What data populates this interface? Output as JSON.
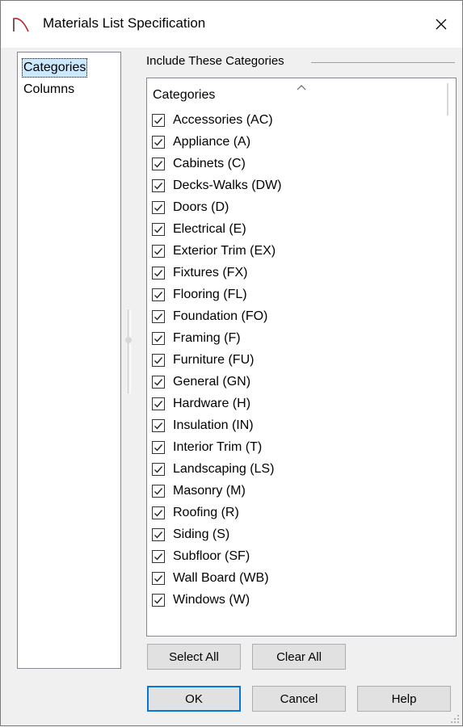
{
  "window": {
    "title": "Materials List Specification",
    "app_icon": "arc-icon",
    "close_icon": "close-icon"
  },
  "nav": {
    "items": [
      {
        "label": "Categories",
        "selected": true
      },
      {
        "label": "Columns",
        "selected": false
      }
    ]
  },
  "group": {
    "title": "Include These Categories"
  },
  "list": {
    "header": "Categories",
    "sort_icon": "sort-up-caret-icon",
    "items": [
      {
        "label": "Accessories (AC)",
        "checked": true
      },
      {
        "label": "Appliance (A)",
        "checked": true
      },
      {
        "label": "Cabinets (C)",
        "checked": true
      },
      {
        "label": "Decks-Walks (DW)",
        "checked": true
      },
      {
        "label": "Doors (D)",
        "checked": true
      },
      {
        "label": "Electrical (E)",
        "checked": true
      },
      {
        "label": "Exterior Trim (EX)",
        "checked": true
      },
      {
        "label": "Fixtures (FX)",
        "checked": true
      },
      {
        "label": "Flooring (FL)",
        "checked": true
      },
      {
        "label": "Foundation (FO)",
        "checked": true
      },
      {
        "label": "Framing (F)",
        "checked": true
      },
      {
        "label": "Furniture (FU)",
        "checked": true
      },
      {
        "label": "General (GN)",
        "checked": true
      },
      {
        "label": "Hardware (H)",
        "checked": true
      },
      {
        "label": "Insulation (IN)",
        "checked": true
      },
      {
        "label": "Interior Trim (T)",
        "checked": true
      },
      {
        "label": "Landscaping (LS)",
        "checked": true
      },
      {
        "label": "Masonry (M)",
        "checked": true
      },
      {
        "label": "Roofing (R)",
        "checked": true
      },
      {
        "label": "Siding (S)",
        "checked": true
      },
      {
        "label": "Subfloor (SF)",
        "checked": true
      },
      {
        "label": "Wall Board (WB)",
        "checked": true
      },
      {
        "label": "Windows (W)",
        "checked": true
      }
    ]
  },
  "buttons": {
    "select_all": "Select All",
    "clear_all": "Clear All",
    "ok": "OK",
    "cancel": "Cancel",
    "help": "Help"
  },
  "colors": {
    "accent": "#0078d7",
    "selection": "#cce8ff",
    "icon_red": "#c0262d"
  }
}
